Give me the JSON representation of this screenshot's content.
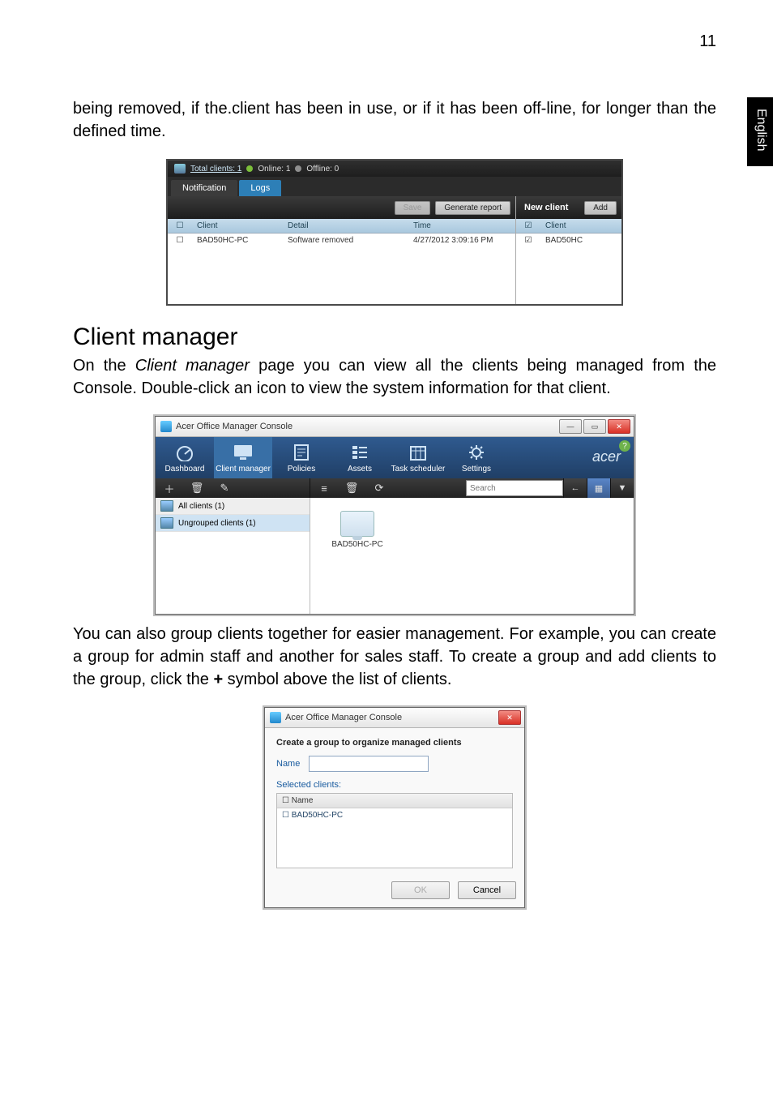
{
  "page_number": "11",
  "side_tab": "English",
  "para1": "being removed, if the.client has been in use, or if it has been off-line, for longer than the defined time.",
  "section_heading": "Client manager",
  "para2_a": "On the ",
  "para2_em": "Client manager",
  "para2_b": " page you can view all the clients being managed from the Console. Double-click an icon to view the system information for that client.",
  "para3_a": "You can also group clients together for easier management. For example, you can create a group for admin staff and another for sales staff. To create a group and add clients to the group, click the ",
  "para3_strong": "+",
  "para3_b": " symbol above the list of clients.",
  "shot1": {
    "totals_text": "Total clients: 1",
    "online_text": "Online: 1",
    "offline_text": "Offline: 0",
    "tab_notification": "Notification",
    "tab_logs": "Logs",
    "btn_save": "Save",
    "btn_generate": "Generate report",
    "right_title": "New client",
    "btn_add": "Add",
    "hdr_client": "Client",
    "hdr_detail": "Detail",
    "hdr_time": "Time",
    "row_client": "BAD50HC-PC",
    "row_detail": "Software removed",
    "row_time": "4/27/2012 3:09:16 PM",
    "right_hdr": "Client",
    "right_row": "BAD50HC"
  },
  "shot2": {
    "title": "Acer Office Manager Console",
    "brand": "acer",
    "nav": {
      "dashboard": "Dashboard",
      "client_manager": "Client manager",
      "policies": "Policies",
      "assets": "Assets",
      "task_scheduler": "Task scheduler",
      "settings": "Settings"
    },
    "search_placeholder": "Search",
    "side_all": "All clients (1)",
    "side_ungrouped": "Ungrouped clients (1)",
    "client_name": "BAD50HC-PC"
  },
  "shot3": {
    "title": "Acer Office Manager Console",
    "heading": "Create a group to organize managed clients",
    "name_label": "Name",
    "selected_clients": "Selected clients:",
    "col_name": "Name",
    "row_name": "BAD50HC-PC",
    "btn_ok": "OK",
    "btn_cancel": "Cancel"
  }
}
